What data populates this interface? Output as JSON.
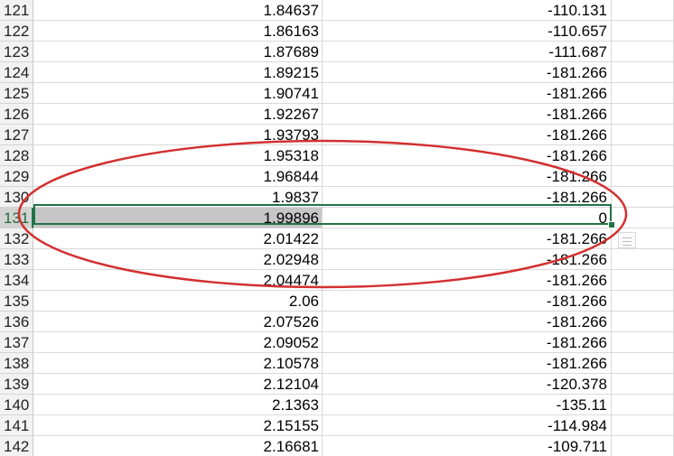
{
  "sheet": {
    "selected_row": "131",
    "rows": [
      {
        "num": "121",
        "a": "1.84637",
        "b": "-110.131"
      },
      {
        "num": "122",
        "a": "1.86163",
        "b": "-110.657"
      },
      {
        "num": "123",
        "a": "1.87689",
        "b": "-111.687"
      },
      {
        "num": "124",
        "a": "1.89215",
        "b": "-181.266"
      },
      {
        "num": "125",
        "a": "1.90741",
        "b": "-181.266"
      },
      {
        "num": "126",
        "a": "1.92267",
        "b": "-181.266"
      },
      {
        "num": "127",
        "a": "1.93793",
        "b": "-181.266"
      },
      {
        "num": "128",
        "a": "1.95318",
        "b": "-181.266"
      },
      {
        "num": "129",
        "a": "1.96844",
        "b": "-181.266"
      },
      {
        "num": "130",
        "a": "1.9837",
        "b": "-181.266"
      },
      {
        "num": "131",
        "a": "1.99896",
        "b": "0"
      },
      {
        "num": "132",
        "a": "2.01422",
        "b": "-181.266"
      },
      {
        "num": "133",
        "a": "2.02948",
        "b": "-181.266"
      },
      {
        "num": "134",
        "a": "2.04474",
        "b": "-181.266"
      },
      {
        "num": "135",
        "a": "2.06",
        "b": "-181.266"
      },
      {
        "num": "136",
        "a": "2.07526",
        "b": "-181.266"
      },
      {
        "num": "137",
        "a": "2.09052",
        "b": "-181.266"
      },
      {
        "num": "138",
        "a": "2.10578",
        "b": "-181.266"
      },
      {
        "num": "139",
        "a": "2.12104",
        "b": "-120.378"
      },
      {
        "num": "140",
        "a": "2.1363",
        "b": "-135.11"
      },
      {
        "num": "141",
        "a": "2.15155",
        "b": "-114.984"
      },
      {
        "num": "142",
        "a": "2.16681",
        "b": "-109.711"
      }
    ]
  },
  "annotation": {
    "ellipse_color": "#d32f2f"
  },
  "colors": {
    "selection_border": "#217346",
    "row_header_bg": "#f2f2f2",
    "highlight_cell_bg": "#c6c6c6"
  },
  "icons": {
    "quick_analysis": "quick-analysis-icon",
    "fill_handle": "fill-handle-icon"
  }
}
